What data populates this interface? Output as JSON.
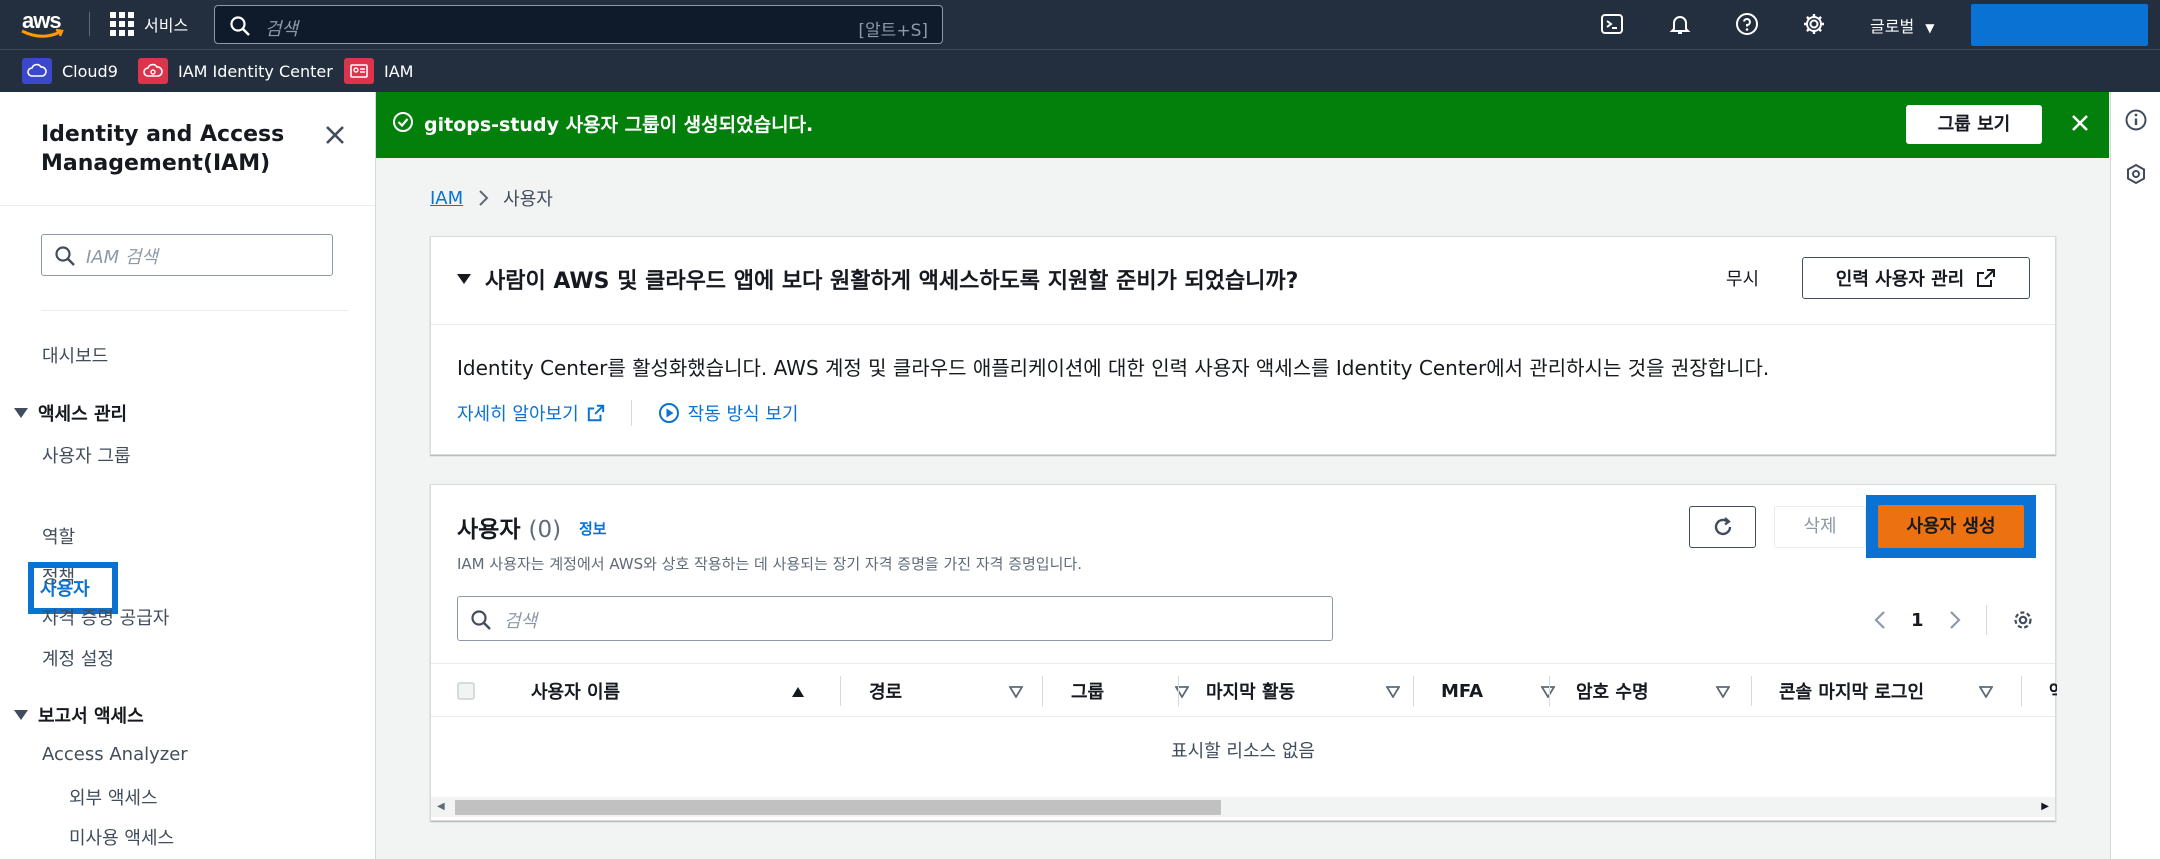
{
  "topbar": {
    "logo_text": "aws",
    "services_label": "서비스",
    "search_placeholder": "검색",
    "search_shortcut": "[알트+S]",
    "region_label": "글로벌",
    "icons": [
      "cloudshell-icon",
      "bell-icon",
      "help-icon",
      "gear-icon"
    ]
  },
  "favorites": [
    {
      "label": "Cloud9",
      "icon": "cloud9-icon",
      "color": "#3b48cc"
    },
    {
      "label": "IAM Identity Center",
      "icon": "identity-center-icon",
      "color": "#dd344c"
    },
    {
      "label": "IAM",
      "icon": "iam-icon",
      "color": "#dd344c"
    }
  ],
  "sidebar": {
    "title": "Identity and Access Management(IAM)",
    "search_placeholder": "IAM 검색",
    "dashboard": "대시보드",
    "access_mgmt": {
      "header": "액세스 관리",
      "items": [
        "사용자 그룹",
        "사용자",
        "역할",
        "정책",
        "자격 증명 공급자",
        "계정 설정"
      ],
      "active": "사용자"
    },
    "report_access": {
      "header": "보고서 액세스",
      "items": [
        "Access Analyzer"
      ],
      "sub_items": [
        "외부 액세스",
        "미사용 액세스"
      ]
    }
  },
  "banner": {
    "message": "gitops-study 사용자 그룹이 생성되었습니다.",
    "view_button": "그룹 보기",
    "color": "#037f0c"
  },
  "breadcrumb": {
    "root": "IAM",
    "current": "사용자"
  },
  "identity_card": {
    "title": "사람이 AWS 및 클라우드 앱에 보다 원활하게 액세스하도록 지원할 준비가 되었습니까?",
    "dismiss": "무시",
    "manage_button": "인력 사용자 관리",
    "body": "Identity Center를 활성화했습니다. AWS 계정 및 클라우드 애플리케이션에 대한 인력 사용자 액세스를 Identity Center에서 관리하시는 것을 권장합니다.",
    "learn_more": "자세히 알아보기",
    "how_it_works": "작동 방식 보기"
  },
  "users_card": {
    "title": "사용자",
    "count": "(0)",
    "info": "정보",
    "description": "IAM 사용자는 계정에서 AWS와 상호 작용하는 데 사용되는 장기 자격 증명을 가진 자격 증명입니다.",
    "delete_button": "삭제",
    "create_button": "사용자 생성",
    "search_placeholder": "검색",
    "page": "1",
    "columns": [
      "사용자 이름",
      "경로",
      "그룹",
      "마지막 활동",
      "MFA",
      "암호 수명",
      "콘솔 마지막 로그인",
      "액"
    ],
    "empty_text": "표시할 리소스 없음",
    "accent": "#ec7211"
  }
}
